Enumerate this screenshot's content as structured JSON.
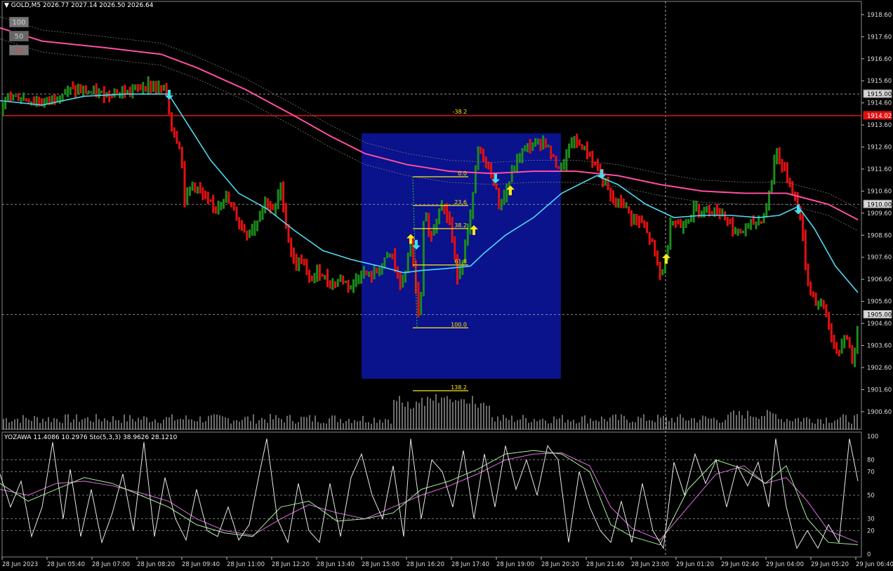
{
  "header": {
    "symbol": "GOLD,M5",
    "ohlc": "2026.77 2027.14 2026.50 2026.64"
  },
  "period_buttons": [
    "100",
    "50",
    "25"
  ],
  "indicator_header": "YOZAWA 11.4086 10.2976  Sto(5,3,3) 38.9626 28.1210",
  "colors": {
    "background": "#000000",
    "bull": "#1c8a1c",
    "bear": "#e01010",
    "ma_slow": "#ff4fa0",
    "ma_fast": "#4fd8f0",
    "fib": "#ffe81a",
    "box": "#0a128c",
    "hline": "#e01010",
    "arrow_up": "#ffe81a",
    "arrow_down": "#3fe0f0"
  },
  "chart_data": {
    "type": "candlestick",
    "ylim": [
      1899.8,
      1919.2
    ],
    "price_ticks": [
      "1918.60",
      "1917.60",
      "1916.60",
      "1915.60",
      "1914.60",
      "1913.60",
      "1912.60",
      "1911.60",
      "1910.60",
      "1909.60",
      "1908.60",
      "1907.60",
      "1906.60",
      "1905.60",
      "1904.60",
      "1903.60",
      "1902.60",
      "1901.60",
      "1900.60"
    ],
    "price_tags": [
      {
        "label": "1915.00",
        "value": 1915.0,
        "style": "grid"
      },
      {
        "label": "1914.02",
        "value": 1914.02,
        "style": "red"
      },
      {
        "label": "1910.00",
        "value": 1910.0,
        "style": "grid"
      },
      {
        "label": "1905.00",
        "value": 1905.0,
        "style": "grid"
      }
    ],
    "horizontal_line": {
      "value": 1914.02,
      "label": "-38.2"
    },
    "time_labels": [
      "28 Jun 2023",
      "28 Jun 05:40",
      "28 Jun 07:00",
      "28 Jun 08:20",
      "28 Jun 09:40",
      "28 Jun 11:00",
      "28 Jun 12:20",
      "28 Jun 13:40",
      "28 Jun 15:00",
      "28 Jun 16:20",
      "28 Jun 17:40",
      "28 Jun 19:00",
      "28 Jun 20:20",
      "28 Jun 21:40",
      "28 Jun 23:00",
      "29 Jun 01:20",
      "29 Jun 02:40",
      "29 Jun 04:00",
      "29 Jun 05:20",
      "29 Jun 06:40"
    ],
    "fibonacci": {
      "levels": [
        {
          "label": "0.0",
          "value": 1911.25
        },
        {
          "label": "23.6",
          "value": 1909.95
        },
        {
          "label": "38.2",
          "value": 1908.9
        },
        {
          "label": "61.8",
          "value": 1907.25
        },
        {
          "label": "100.0",
          "value": 1904.4
        },
        {
          "label": "138.2",
          "value": 1901.55
        }
      ]
    },
    "price_path": [
      [
        0,
        1913.8
      ],
      [
        10,
        1915.0
      ],
      [
        30,
        1914.8
      ],
      [
        60,
        1914.6
      ],
      [
        100,
        1915.2
      ],
      [
        140,
        1915.0
      ],
      [
        180,
        1915.1
      ],
      [
        210,
        1915.4
      ],
      [
        236,
        1915.2
      ],
      [
        244,
        1913.5
      ],
      [
        258,
        1912.5
      ],
      [
        262,
        1910.2
      ],
      [
        275,
        1911.0
      ],
      [
        290,
        1910.3
      ],
      [
        305,
        1909.8
      ],
      [
        320,
        1910.4
      ],
      [
        335,
        1909.5
      ],
      [
        352,
        1908.6
      ],
      [
        365,
        1909.2
      ],
      [
        378,
        1910.2
      ],
      [
        390,
        1909.6
      ],
      [
        400,
        1910.8
      ],
      [
        410,
        1908.5
      ],
      [
        420,
        1907.2
      ],
      [
        430,
        1907.5
      ],
      [
        440,
        1906.5
      ],
      [
        455,
        1907.0
      ],
      [
        470,
        1906.4
      ],
      [
        485,
        1906.6
      ],
      [
        500,
        1906.3
      ],
      [
        515,
        1906.9
      ],
      [
        530,
        1906.7
      ],
      [
        545,
        1907.3
      ],
      [
        558,
        1907.8
      ],
      [
        570,
        1906.2
      ],
      [
        580,
        1907.3
      ],
      [
        586,
        1908.3
      ],
      [
        592,
        1906.2
      ],
      [
        598,
        1904.4
      ],
      [
        604,
        1909.6
      ],
      [
        615,
        1908.5
      ],
      [
        628,
        1910.2
      ],
      [
        640,
        1909.2
      ],
      [
        652,
        1906.7
      ],
      [
        662,
        1908.0
      ],
      [
        672,
        1909.8
      ],
      [
        680,
        1912.5
      ],
      [
        692,
        1911.9
      ],
      [
        704,
        1911.0
      ],
      [
        712,
        1909.9
      ],
      [
        720,
        1910.5
      ],
      [
        730,
        1911.5
      ],
      [
        745,
        1912.5
      ],
      [
        760,
        1912.7
      ],
      [
        775,
        1912.9
      ],
      [
        790,
        1911.9
      ],
      [
        800,
        1911.6
      ],
      [
        815,
        1912.9
      ],
      [
        830,
        1912.6
      ],
      [
        845,
        1912.0
      ],
      [
        858,
        1911.2
      ],
      [
        872,
        1910.1
      ],
      [
        885,
        1910.1
      ],
      [
        900,
        1909.4
      ],
      [
        915,
        1909.1
      ],
      [
        930,
        1908.1
      ],
      [
        940,
        1906.8
      ],
      [
        948,
        1907.4
      ],
      [
        955,
        1909.3
      ],
      [
        970,
        1909.0
      ],
      [
        990,
        1909.8
      ],
      [
        1010,
        1909.8
      ],
      [
        1030,
        1909.6
      ],
      [
        1050,
        1908.6
      ],
      [
        1065,
        1909.0
      ],
      [
        1080,
        1909.2
      ],
      [
        1090,
        1909.6
      ],
      [
        1098,
        1910.8
      ],
      [
        1105,
        1912.6
      ],
      [
        1115,
        1911.6
      ],
      [
        1125,
        1911.0
      ],
      [
        1132,
        1910.3
      ],
      [
        1140,
        1909.5
      ],
      [
        1150,
        1906.5
      ],
      [
        1162,
        1905.6
      ],
      [
        1175,
        1905.3
      ],
      [
        1185,
        1903.8
      ],
      [
        1195,
        1903.1
      ],
      [
        1205,
        1904.2
      ],
      [
        1215,
        1902.8
      ],
      [
        1222,
        1904.3
      ]
    ],
    "ma_slow_path": [
      [
        0,
        1918.0
      ],
      [
        60,
        1917.4
      ],
      [
        150,
        1917.1
      ],
      [
        230,
        1916.8
      ],
      [
        280,
        1916.2
      ],
      [
        350,
        1915.2
      ],
      [
        420,
        1914.0
      ],
      [
        470,
        1913.1
      ],
      [
        520,
        1912.3
      ],
      [
        580,
        1911.8
      ],
      [
        640,
        1911.5
      ],
      [
        700,
        1911.4
      ],
      [
        760,
        1911.5
      ],
      [
        820,
        1911.5
      ],
      [
        880,
        1911.3
      ],
      [
        940,
        1910.9
      ],
      [
        1000,
        1910.6
      ],
      [
        1060,
        1910.5
      ],
      [
        1120,
        1910.5
      ],
      [
        1180,
        1910.0
      ],
      [
        1222,
        1909.3
      ]
    ],
    "ma_fast_path": [
      [
        0,
        1914.7
      ],
      [
        60,
        1914.5
      ],
      [
        120,
        1914.9
      ],
      [
        180,
        1915.0
      ],
      [
        240,
        1915.0
      ],
      [
        270,
        1913.5
      ],
      [
        300,
        1912.0
      ],
      [
        340,
        1910.5
      ],
      [
        380,
        1909.8
      ],
      [
        420,
        1908.8
      ],
      [
        460,
        1907.9
      ],
      [
        500,
        1907.5
      ],
      [
        540,
        1907.2
      ],
      [
        575,
        1906.9
      ],
      [
        600,
        1907.0
      ],
      [
        640,
        1907.1
      ],
      [
        670,
        1907.2
      ],
      [
        690,
        1907.8
      ],
      [
        720,
        1908.6
      ],
      [
        760,
        1909.4
      ],
      [
        800,
        1910.5
      ],
      [
        850,
        1911.3
      ],
      [
        880,
        1910.9
      ],
      [
        920,
        1910.0
      ],
      [
        960,
        1909.4
      ],
      [
        1000,
        1909.5
      ],
      [
        1040,
        1909.5
      ],
      [
        1080,
        1909.4
      ],
      [
        1110,
        1909.5
      ],
      [
        1137,
        1909.9
      ],
      [
        1160,
        1908.9
      ],
      [
        1190,
        1907.2
      ],
      [
        1222,
        1906.0
      ]
    ],
    "arrows": [
      {
        "x": 241,
        "value": 1915.0,
        "dir": "down"
      },
      {
        "x": 585,
        "value": 1908.4,
        "dir": "up"
      },
      {
        "x": 593,
        "value": 1908.2,
        "dir": "down"
      },
      {
        "x": 675,
        "value": 1908.8,
        "dir": "up"
      },
      {
        "x": 706,
        "value": 1911.2,
        "dir": "down"
      },
      {
        "x": 727,
        "value": 1910.6,
        "dir": "up"
      },
      {
        "x": 857,
        "value": 1911.4,
        "dir": "down"
      },
      {
        "x": 949,
        "value": 1907.5,
        "dir": "up"
      },
      {
        "x": 1137,
        "value": 1909.8,
        "dir": "down"
      }
    ],
    "oscillator": {
      "ylim": [
        0,
        100
      ],
      "ticks": [
        "100",
        "80",
        "70",
        "50",
        "30",
        "20",
        "0"
      ],
      "levels": [
        80,
        70,
        50,
        30,
        20
      ],
      "series_white_path": [
        [
          0,
          68
        ],
        [
          15,
          40
        ],
        [
          30,
          62
        ],
        [
          45,
          15
        ],
        [
          60,
          40
        ],
        [
          75,
          95
        ],
        [
          90,
          30
        ],
        [
          100,
          72
        ],
        [
          115,
          15
        ],
        [
          130,
          55
        ],
        [
          145,
          10
        ],
        [
          160,
          35
        ],
        [
          175,
          68
        ],
        [
          190,
          20
        ],
        [
          205,
          95
        ],
        [
          220,
          15
        ],
        [
          235,
          65
        ],
        [
          250,
          30
        ],
        [
          265,
          12
        ],
        [
          280,
          55
        ],
        [
          295,
          20
        ],
        [
          310,
          15
        ],
        [
          325,
          40
        ],
        [
          340,
          12
        ],
        [
          355,
          25
        ],
        [
          370,
          70
        ],
        [
          380,
          98
        ],
        [
          395,
          30
        ],
        [
          410,
          10
        ],
        [
          425,
          60
        ],
        [
          440,
          20
        ],
        [
          455,
          10
        ],
        [
          470,
          60
        ],
        [
          485,
          15
        ],
        [
          500,
          65
        ],
        [
          515,
          85
        ],
        [
          530,
          50
        ],
        [
          545,
          30
        ],
        [
          560,
          75
        ],
        [
          575,
          15
        ],
        [
          585,
          98
        ],
        [
          600,
          30
        ],
        [
          615,
          80
        ],
        [
          630,
          70
        ],
        [
          645,
          40
        ],
        [
          660,
          88
        ],
        [
          675,
          30
        ],
        [
          690,
          85
        ],
        [
          705,
          40
        ],
        [
          720,
          92
        ],
        [
          735,
          55
        ],
        [
          750,
          80
        ],
        [
          765,
          50
        ],
        [
          780,
          92
        ],
        [
          795,
          80
        ],
        [
          810,
          10
        ],
        [
          825,
          70
        ],
        [
          840,
          40
        ],
        [
          855,
          20
        ],
        [
          870,
          10
        ],
        [
          885,
          45
        ],
        [
          900,
          10
        ],
        [
          915,
          60
        ],
        [
          930,
          20
        ],
        [
          945,
          5
        ],
        [
          960,
          78
        ],
        [
          975,
          50
        ],
        [
          990,
          85
        ],
        [
          1005,
          60
        ],
        [
          1020,
          80
        ],
        [
          1035,
          40
        ],
        [
          1050,
          75
        ],
        [
          1065,
          58
        ],
        [
          1080,
          78
        ],
        [
          1095,
          40
        ],
        [
          1105,
          98
        ],
        [
          1120,
          40
        ],
        [
          1135,
          5
        ],
        [
          1150,
          20
        ],
        [
          1165,
          5
        ],
        [
          1180,
          25
        ],
        [
          1195,
          10
        ],
        [
          1210,
          98
        ],
        [
          1222,
          62
        ]
      ],
      "series_green_path": [
        [
          0,
          60
        ],
        [
          40,
          45
        ],
        [
          80,
          55
        ],
        [
          120,
          65
        ],
        [
          160,
          60
        ],
        [
          200,
          50
        ],
        [
          240,
          40
        ],
        [
          280,
          25
        ],
        [
          320,
          18
        ],
        [
          360,
          15
        ],
        [
          400,
          40
        ],
        [
          440,
          45
        ],
        [
          480,
          28
        ],
        [
          520,
          30
        ],
        [
          560,
          35
        ],
        [
          600,
          55
        ],
        [
          640,
          62
        ],
        [
          680,
          72
        ],
        [
          720,
          85
        ],
        [
          760,
          88
        ],
        [
          800,
          85
        ],
        [
          840,
          70
        ],
        [
          870,
          25
        ],
        [
          900,
          15
        ],
        [
          940,
          8
        ],
        [
          980,
          55
        ],
        [
          1020,
          80
        ],
        [
          1060,
          72
        ],
        [
          1090,
          60
        ],
        [
          1120,
          75
        ],
        [
          1150,
          30
        ],
        [
          1180,
          10
        ],
        [
          1222,
          8
        ]
      ],
      "series_pink_path": [
        [
          0,
          55
        ],
        [
          40,
          50
        ],
        [
          80,
          60
        ],
        [
          120,
          62
        ],
        [
          160,
          58
        ],
        [
          200,
          52
        ],
        [
          240,
          45
        ],
        [
          280,
          30
        ],
        [
          320,
          20
        ],
        [
          360,
          16
        ],
        [
          400,
          30
        ],
        [
          440,
          42
        ],
        [
          480,
          35
        ],
        [
          520,
          30
        ],
        [
          560,
          40
        ],
        [
          600,
          50
        ],
        [
          640,
          58
        ],
        [
          680,
          68
        ],
        [
          720,
          80
        ],
        [
          760,
          85
        ],
        [
          800,
          86
        ],
        [
          840,
          75
        ],
        [
          870,
          40
        ],
        [
          900,
          22
        ],
        [
          940,
          12
        ],
        [
          980,
          40
        ],
        [
          1020,
          68
        ],
        [
          1060,
          75
        ],
        [
          1090,
          60
        ],
        [
          1120,
          65
        ],
        [
          1150,
          45
        ],
        [
          1180,
          20
        ],
        [
          1222,
          10
        ]
      ]
    }
  }
}
